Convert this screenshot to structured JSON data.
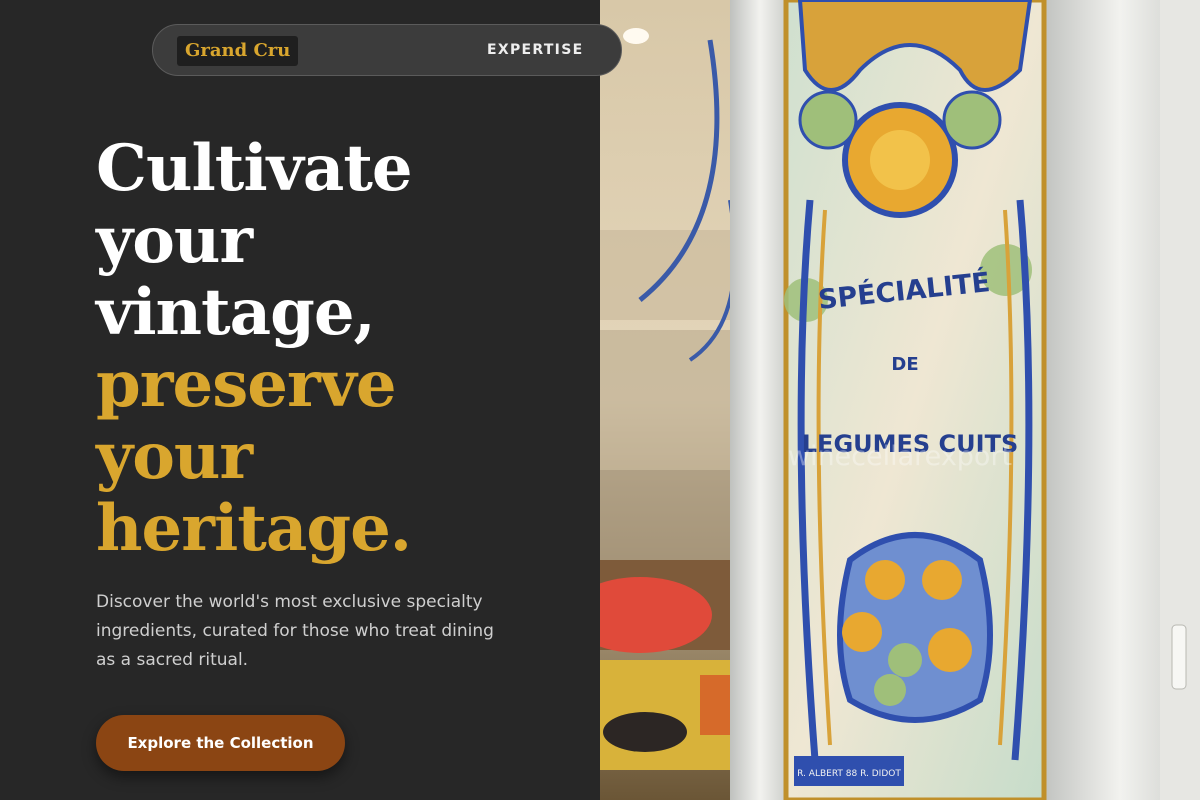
{
  "nav": {
    "logo": "Grand Cru",
    "links": [
      "EXPERTISE"
    ]
  },
  "hero": {
    "headline_white": [
      "Cultivate",
      "your",
      "vintage,"
    ],
    "headline_gold": [
      "preserve",
      "your",
      "heritage."
    ],
    "subtext": "Discover the world's most exclusive specialty ingredients, curated for those who treat dining as a sacred ritual.",
    "cta_label": "Explore the Collection"
  },
  "photo": {
    "sign_lines": [
      "SPÉCIALITÉ",
      "DE",
      "LEGUMES CUITS"
    ],
    "watermark": "winecellarexport",
    "maker_plate": "R. ALBERT 88 R. DIDOT"
  },
  "colors": {
    "background": "#272727",
    "accent_gold": "#d9a62e",
    "cta_brown": "#8b4513",
    "nav_pill": "#3c3c3c"
  }
}
